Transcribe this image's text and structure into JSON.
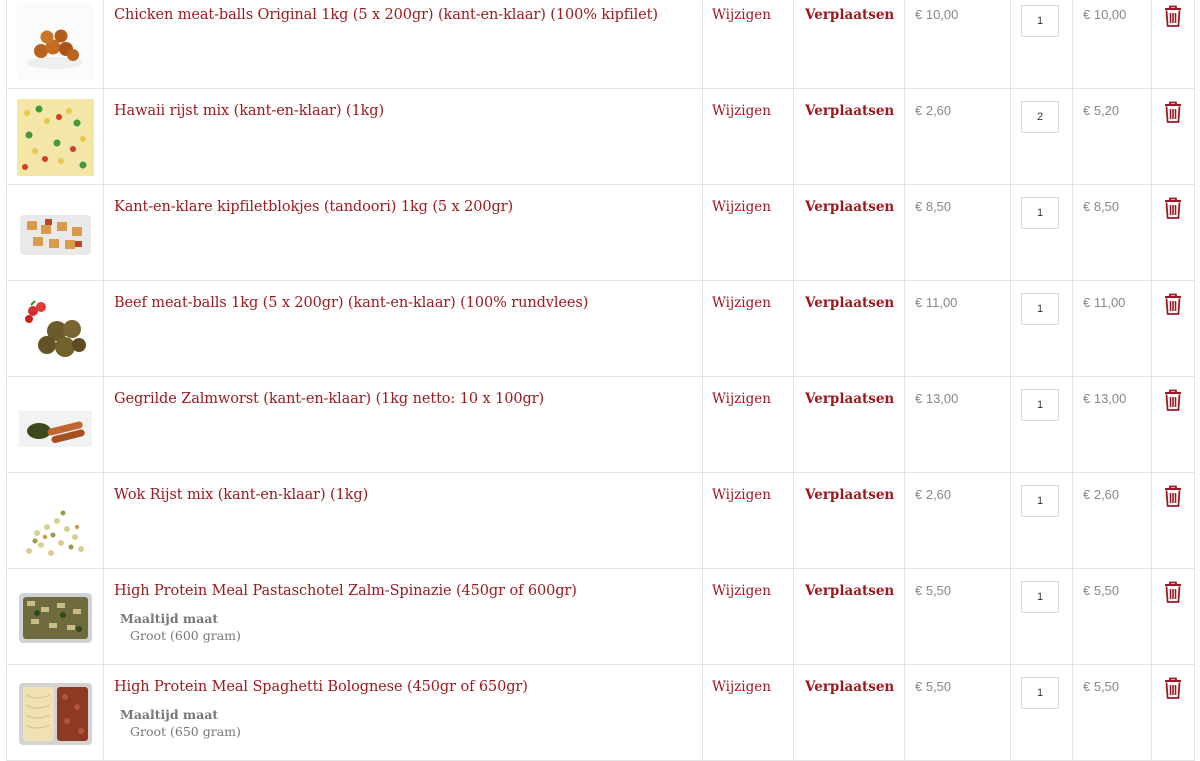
{
  "cart": {
    "rows": [
      {
        "name": "Chicken meat-balls Original 1kg (5 x 200gr) (kant-en-klaar) (100% kipfilet)",
        "edit": "Wijzigen",
        "move": "Verplaatsen",
        "price": "€ 10,00",
        "qty": "1",
        "subtotal": "€ 10,00",
        "thumb": "meatballs",
        "option_label": "",
        "option_value": ""
      },
      {
        "name": "Hawaii rijst mix (kant-en-klaar) (1kg)",
        "edit": "Wijzigen",
        "move": "Verplaatsen",
        "price": "€ 2,60",
        "qty": "2",
        "subtotal": "€ 5,20",
        "thumb": "rice-mix",
        "option_label": "",
        "option_value": ""
      },
      {
        "name": "Kant-en-klare kipfiletblokjes (tandoori) 1kg (5 x 200gr)",
        "edit": "Wijzigen",
        "move": "Verplaatsen",
        "price": "€ 8,50",
        "qty": "1",
        "subtotal": "€ 8,50",
        "thumb": "chicken-cubes",
        "option_label": "",
        "option_value": ""
      },
      {
        "name": "Beef meat-balls 1kg (5 x 200gr) (kant-en-klaar) (100% rundvlees)",
        "edit": "Wijzigen",
        "move": "Verplaatsen",
        "price": "€ 11,00",
        "qty": "1",
        "subtotal": "€ 11,00",
        "thumb": "beef-meatballs",
        "option_label": "",
        "option_value": ""
      },
      {
        "name": "Gegrilde Zalmworst (kant-en-klaar) (1kg netto: 10 x 100gr)",
        "edit": "Wijzigen",
        "move": "Verplaatsen",
        "price": "€ 13,00",
        "qty": "1",
        "subtotal": "€ 13,00",
        "thumb": "salmon-sausage",
        "option_label": "",
        "option_value": ""
      },
      {
        "name": "Wok Rijst mix (kant-en-klaar) (1kg)",
        "edit": "Wijzigen",
        "move": "Verplaatsen",
        "price": "€ 2,60",
        "qty": "1",
        "subtotal": "€ 2,60",
        "thumb": "wok-rice",
        "option_label": "",
        "option_value": ""
      },
      {
        "name": "High Protein Meal Pastaschotel Zalm-Spinazie (450gr of 600gr)",
        "edit": "Wijzigen",
        "move": "Verplaatsen",
        "price": "€ 5,50",
        "qty": "1",
        "subtotal": "€ 5,50",
        "thumb": "pasta-tray",
        "option_label": "Maaltijd maat",
        "option_value": "Groot (600 gram)"
      },
      {
        "name": "High Protein Meal Spaghetti Bolognese (450gr of 650gr)",
        "edit": "Wijzigen",
        "move": "Verplaatsen",
        "price": "€ 5,50",
        "qty": "1",
        "subtotal": "€ 5,50",
        "thumb": "bolognese-tray",
        "option_label": "Maaltijd maat",
        "option_value": "Groot (650 gram)"
      }
    ]
  },
  "colors": {
    "accent": "#9b1b20",
    "muted": "#888888",
    "border": "#e4e4e4"
  },
  "icons": {
    "remove": "trash-icon"
  }
}
